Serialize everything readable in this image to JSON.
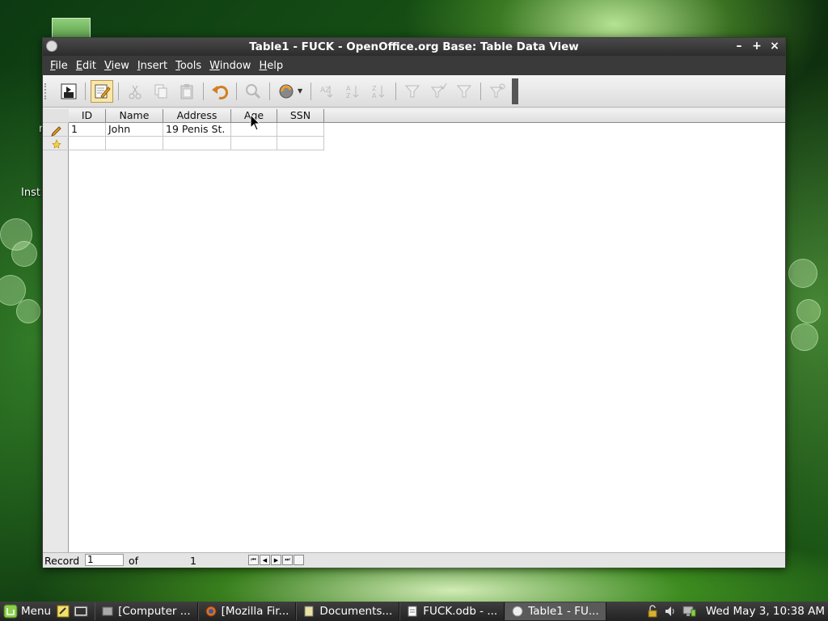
{
  "desktop": {
    "partial_labels": [
      "r",
      "Inst"
    ]
  },
  "window": {
    "title": "Table1 - FUCK - OpenOffice.org Base: Table Data View",
    "controls": {
      "minimize": "–",
      "maximize": "+",
      "close": "×"
    }
  },
  "menu": {
    "items": [
      {
        "label": "File",
        "u": "F",
        "rest": "ile"
      },
      {
        "label": "Edit",
        "u": "E",
        "rest": "dit"
      },
      {
        "label": "View",
        "u": "V",
        "rest": "iew"
      },
      {
        "label": "Insert",
        "u": "I",
        "rest": "nsert"
      },
      {
        "label": "Tools",
        "u": "T",
        "rest": "ools"
      },
      {
        "label": "Window",
        "u": "W",
        "rest": "indow"
      },
      {
        "label": "Help",
        "u": "H",
        "rest": "elp"
      }
    ]
  },
  "table": {
    "columns": [
      "ID",
      "Name",
      "Address",
      "Age",
      "SSN"
    ],
    "rows": [
      [
        "1",
        "John",
        "19 Penis St.",
        "",
        ""
      ]
    ]
  },
  "recordbar": {
    "label": "Record",
    "current": "1",
    "of": "of",
    "total": "1"
  },
  "taskbar": {
    "menu_label": "Menu",
    "tasks": [
      "[Computer ...",
      "[Mozilla Fir...",
      "Documents...",
      "FUCK.odb - ...",
      "Table1 - FU..."
    ],
    "clock": "Wed May  3, 10:38 AM"
  },
  "colors": {
    "titlebar": "#2c2c2c",
    "menubar": "#3a3a3a",
    "active_tool": "#fbe6a6",
    "desktop_green": "#154d14"
  }
}
